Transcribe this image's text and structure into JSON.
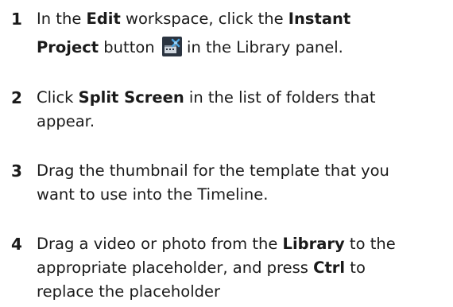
{
  "steps": [
    {
      "number": "1",
      "line1": {
        "t1": "In the ",
        "b1": "Edit",
        "t2": " workspace, click the ",
        "b2": "Instant"
      },
      "line2": {
        "b1": "Project",
        "t1": " button ",
        "t2": " in the Library panel."
      },
      "icon": "instant-project-icon"
    },
    {
      "number": "2",
      "line1": {
        "t1": "Click ",
        "b1": "Split Screen",
        "t2": " in the list of folders that"
      },
      "line2": "appear."
    },
    {
      "number": "3",
      "line1": "Drag the thumbnail for the template that you",
      "line2": "want to use into the Timeline."
    },
    {
      "number": "4",
      "line1": {
        "t1": "Drag a video or photo from the ",
        "b1": "Library",
        "t2": " to the"
      },
      "line2": {
        "t1": "appropriate placeholder, and press ",
        "b1": "Ctrl",
        "t2": " to"
      },
      "line3": "replace the placeholder"
    }
  ],
  "colors": {
    "text": "#1a1a1a",
    "icon_bg": "#2b3440",
    "icon_accent": "#4aa3df"
  }
}
